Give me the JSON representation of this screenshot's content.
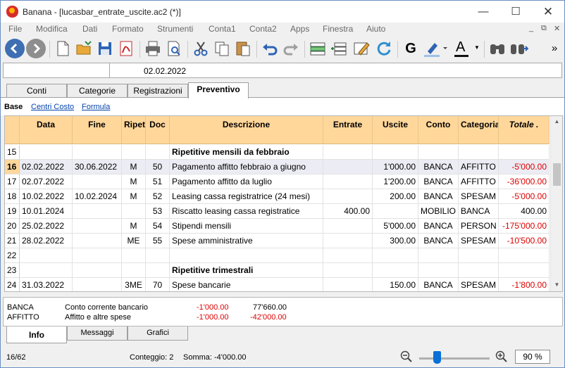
{
  "window": {
    "title": "Banana - [lucasbar_entrate_uscite.ac2 (*)]",
    "minimize": "—",
    "maximize": "☐",
    "close": "✕"
  },
  "menu": [
    "File",
    "Modifica",
    "Dati",
    "Formato",
    "Strumenti",
    "Conta1",
    "Conta2",
    "Apps",
    "Finestra",
    "Aiuto"
  ],
  "mdi": {
    "minimize": "_",
    "restore": "⧉",
    "close": "✕"
  },
  "toolbar": {
    "icons": [
      "back-icon",
      "forward-icon",
      "new-file-icon",
      "open-folder-icon",
      "save-icon",
      "pdf-icon",
      "print-icon",
      "print-preview-icon",
      "cut-icon",
      "copy-icon",
      "paste-icon",
      "undo-icon",
      "redo-icon",
      "insert-rows-icon",
      "add-rows-icon",
      "edit-icon",
      "refresh-icon",
      "bold-icon",
      "highlight-icon",
      "font-color-icon",
      "find-icon",
      "find-next-icon",
      "more-icon"
    ],
    "bold_glyph": "G",
    "font_glyph": "A",
    "more_glyph": "»"
  },
  "cell_editor": {
    "value": "02.02.2022"
  },
  "table_tabs": [
    "Conti",
    "Categorie",
    "Registrazioni",
    "Preventivo"
  ],
  "active_table_tab": 3,
  "views": [
    "Base",
    "Centri Costo",
    "Formula"
  ],
  "columns": [
    "",
    "Data",
    "Fine",
    "Ripeti",
    "Doc",
    "Descrizione",
    "Entrate",
    "Uscite",
    "Conto",
    "Categoria",
    "Totale ."
  ],
  "rows": [
    {
      "n": "15",
      "data": "",
      "fine": "",
      "ripeti": "",
      "doc": "",
      "desc": "Ripetitive mensili da febbraio",
      "entrate": "",
      "uscite": "",
      "conto": "",
      "categoria": "",
      "totale": "",
      "bold": true
    },
    {
      "n": "16",
      "data": "02.02.2022",
      "fine": "30.06.2022",
      "ripeti": "M",
      "doc": "50",
      "desc": "Pagamento affitto febbraio a giugno",
      "entrate": "",
      "uscite": "1'000.00",
      "conto": "BANCA",
      "categoria": "AFFITTO",
      "totale": "-5'000.00",
      "neg": true,
      "selected": true
    },
    {
      "n": "17",
      "data": "02.07.2022",
      "fine": "",
      "ripeti": "M",
      "doc": "51",
      "desc": "Pagamento affitto da luglio",
      "entrate": "",
      "uscite": "1'200.00",
      "conto": "BANCA",
      "categoria": "AFFITTO",
      "totale": "-36'000.00",
      "neg": true
    },
    {
      "n": "18",
      "data": "10.02.2022",
      "fine": "10.02.2024",
      "ripeti": "M",
      "doc": "52",
      "desc": "Leasing cassa registratrice (24 mesi)",
      "entrate": "",
      "uscite": "200.00",
      "conto": "BANCA",
      "categoria": "SPESAM",
      "totale": "-5'000.00",
      "neg": true
    },
    {
      "n": "19",
      "data": "10.01.2024",
      "fine": "",
      "ripeti": "",
      "doc": "53",
      "desc": "Riscatto leasing cassa registratice",
      "entrate": "400.00",
      "uscite": "",
      "conto": "MOBILIO",
      "categoria": "BANCA",
      "totale": "400.00"
    },
    {
      "n": "20",
      "data": "25.02.2022",
      "fine": "",
      "ripeti": "M",
      "doc": "54",
      "desc": "Stipendi mensili",
      "entrate": "",
      "uscite": "5'000.00",
      "conto": "BANCA",
      "categoria": "PERSON",
      "totale": "-175'000.00",
      "neg": true
    },
    {
      "n": "21",
      "data": "28.02.2022",
      "fine": "",
      "ripeti": "ME",
      "doc": "55",
      "desc": "Spese amministrative",
      "entrate": "",
      "uscite": "300.00",
      "conto": "BANCA",
      "categoria": "SPESAM",
      "totale": "-10'500.00",
      "neg": true
    },
    {
      "n": "22",
      "data": "",
      "fine": "",
      "ripeti": "",
      "doc": "",
      "desc": "",
      "entrate": "",
      "uscite": "",
      "conto": "",
      "categoria": "",
      "totale": ""
    },
    {
      "n": "23",
      "data": "",
      "fine": "",
      "ripeti": "",
      "doc": "",
      "desc": "Ripetitive trimestrali",
      "entrate": "",
      "uscite": "",
      "conto": "",
      "categoria": "",
      "totale": "",
      "bold": true
    },
    {
      "n": "24",
      "data": "31.03.2022",
      "fine": "",
      "ripeti": "3ME",
      "doc": "70",
      "desc": "Spese bancarie",
      "entrate": "",
      "uscite": "150.00",
      "conto": "BANCA",
      "categoria": "SPESAM",
      "totale": "-1'800.00",
      "neg": true
    }
  ],
  "info_panel": [
    {
      "account": "BANCA",
      "description": "Conto corrente bancario",
      "amount": "-1'000.00",
      "balance": "77'660.00"
    },
    {
      "account": "AFFITTO",
      "description": "Affitto e altre spese",
      "amount": "-1'000.00",
      "balance": "-42'000.00"
    }
  ],
  "bottom_tabs": [
    "Info",
    "Messaggi",
    "Grafici"
  ],
  "status": {
    "position": "16/62",
    "count": "Conteggio: 2",
    "sum": "Somma: -4'000.00",
    "zoom": "90 %",
    "zoom_level_percent": 90
  },
  "colors": {
    "header": "#ffd79b",
    "negative": "#dd0000",
    "link": "#0645ad",
    "accent": "#0a6fd6"
  }
}
